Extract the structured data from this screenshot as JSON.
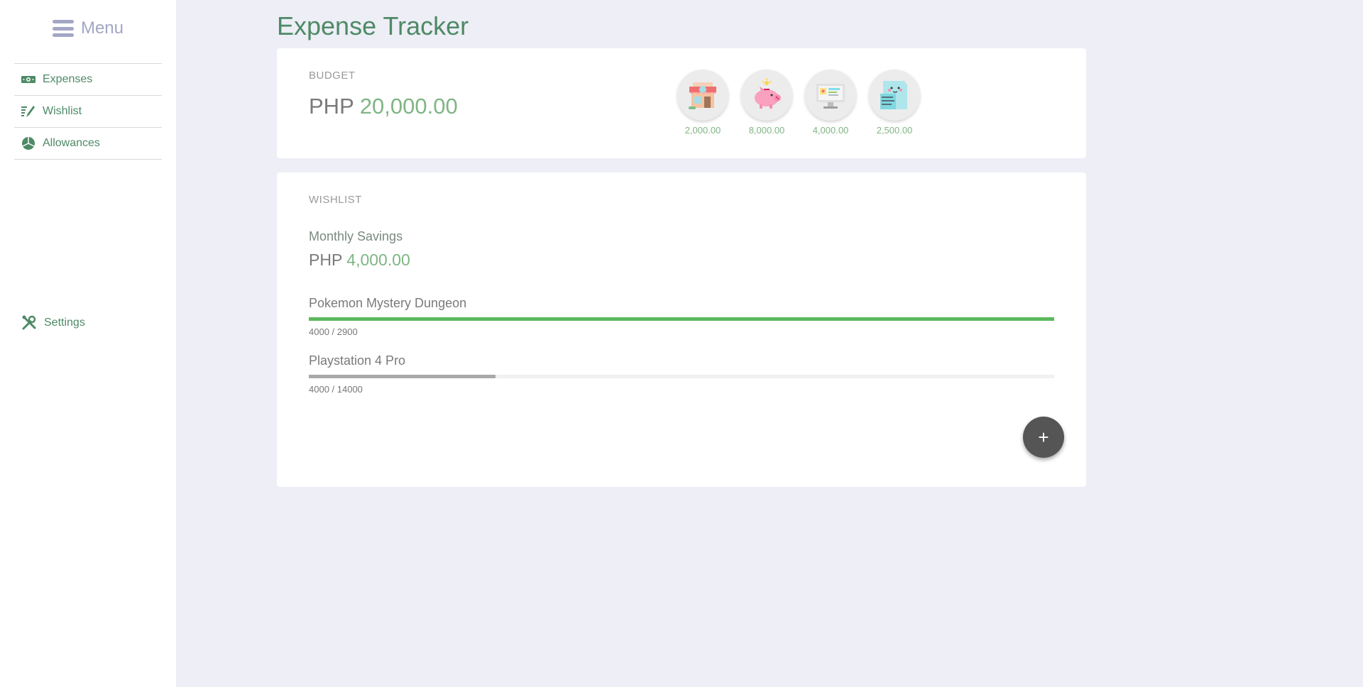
{
  "sidebar": {
    "menu_label": "Menu",
    "items": [
      {
        "label": "Expenses",
        "icon": "money-icon"
      },
      {
        "label": "Wishlist",
        "icon": "wishlist-icon"
      },
      {
        "label": "Allowances",
        "icon": "pie-chart-icon"
      }
    ],
    "settings_label": "Settings"
  },
  "header": {
    "title": "Expense Tracker"
  },
  "budget": {
    "label": "BUDGET",
    "currency": "PHP",
    "amount": "20,000.00",
    "categories": [
      {
        "icon": "store-icon",
        "amount": "2,000.00"
      },
      {
        "icon": "piggy-bank-icon",
        "amount": "8,000.00"
      },
      {
        "icon": "computer-icon",
        "amount": "4,000.00"
      },
      {
        "icon": "receipt-icon",
        "amount": "2,500.00"
      }
    ]
  },
  "wishlist": {
    "label": "WISHLIST",
    "monthly_label": "Monthly Savings",
    "currency": "PHP",
    "monthly_amount": "4,000.00",
    "items": [
      {
        "name": "Pokemon Mystery Dungeon",
        "progress_text": "4000 / 2900",
        "fill_fraction": 1.0,
        "fill_color": "#5cb85c"
      },
      {
        "name": "Playstation 4 Pro",
        "progress_text": "4000 / 14000",
        "fill_fraction": 0.25,
        "fill_color": "#a9a9a9"
      }
    ],
    "add_label": "+"
  },
  "colors": {
    "brand_green": "#4e8a66",
    "amount_green": "#7fb584",
    "background": "#edeef6"
  }
}
